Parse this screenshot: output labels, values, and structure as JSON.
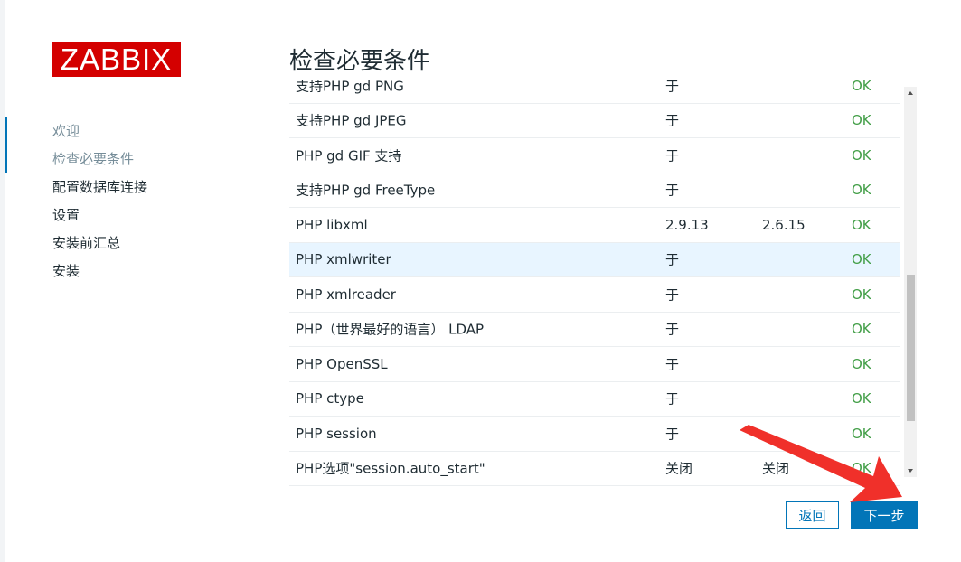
{
  "logo": {
    "text": "ZABBIX"
  },
  "nav": {
    "items": [
      {
        "label": "欢迎"
      },
      {
        "label": "检查必要条件"
      },
      {
        "label": "配置数据库连接"
      },
      {
        "label": "设置"
      },
      {
        "label": "安装前汇总"
      },
      {
        "label": "安装"
      }
    ]
  },
  "page": {
    "title": "检查必要条件"
  },
  "table": {
    "rows": [
      {
        "name": "支持PHP gd PNG",
        "current": "于",
        "required": "",
        "status": "OK"
      },
      {
        "name": "支持PHP gd JPEG",
        "current": "于",
        "required": "",
        "status": "OK"
      },
      {
        "name": "PHP gd GIF 支持",
        "current": "于",
        "required": "",
        "status": "OK"
      },
      {
        "name": "支持PHP gd FreeType",
        "current": "于",
        "required": "",
        "status": "OK"
      },
      {
        "name": "PHP libxml",
        "current": "2.9.13",
        "required": "2.6.15",
        "status": "OK"
      },
      {
        "name": "PHP xmlwriter",
        "current": "于",
        "required": "",
        "status": "OK"
      },
      {
        "name": "PHP xmlreader",
        "current": "于",
        "required": "",
        "status": "OK"
      },
      {
        "name": "PHP（世界最好的语言） LDAP",
        "current": "于",
        "required": "",
        "status": "OK"
      },
      {
        "name": "PHP OpenSSL",
        "current": "于",
        "required": "",
        "status": "OK"
      },
      {
        "name": "PHP ctype",
        "current": "于",
        "required": "",
        "status": "OK"
      },
      {
        "name": "PHP session",
        "current": "于",
        "required": "",
        "status": "OK"
      },
      {
        "name": "PHP选项\"session.auto_start\"",
        "current": "关闭",
        "required": "关闭",
        "status": "OK"
      }
    ]
  },
  "buttons": {
    "back": "返回",
    "next": "下一步"
  },
  "colors": {
    "brand": "#d40000",
    "accent": "#0275b8",
    "ok": "#429e47",
    "arrow": "#f0302a",
    "highlight": "#e8f5ff"
  }
}
